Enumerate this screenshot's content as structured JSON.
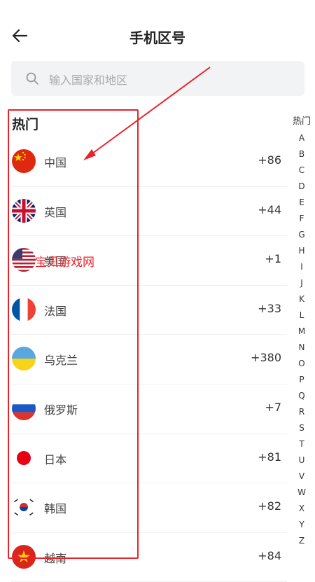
{
  "header": {
    "title": "手机区号"
  },
  "search": {
    "placeholder": "输入国家和地区"
  },
  "section": {
    "hot_label": "热门"
  },
  "countries": [
    {
      "name": "中国",
      "code": "+86",
      "flag": "china-flag"
    },
    {
      "name": "英国",
      "code": "+44",
      "flag": "uk-flag"
    },
    {
      "name": "美国",
      "code": "+1",
      "flag": "usa-flag"
    },
    {
      "name": "法国",
      "code": "+33",
      "flag": "france-flag"
    },
    {
      "name": "乌克兰",
      "code": "+380",
      "flag": "ukraine-flag"
    },
    {
      "name": "俄罗斯",
      "code": "+7",
      "flag": "russia-flag"
    },
    {
      "name": "日本",
      "code": "+81",
      "flag": "japan-flag"
    },
    {
      "name": "韩国",
      "code": "+82",
      "flag": "korea-flag"
    },
    {
      "name": "越南",
      "code": "+84",
      "flag": "vietnam-flag"
    }
  ],
  "index": {
    "hot": "热门",
    "letters": [
      "A",
      "B",
      "C",
      "D",
      "E",
      "F",
      "G",
      "H",
      "I",
      "J",
      "K",
      "L",
      "M",
      "N",
      "O",
      "P",
      "Q",
      "R",
      "S",
      "T",
      "U",
      "V",
      "W",
      "X",
      "Y",
      "Z"
    ]
  },
  "overlay": {
    "watermark": "宝贝游戏网",
    "annotation_color": "#e8232a"
  }
}
